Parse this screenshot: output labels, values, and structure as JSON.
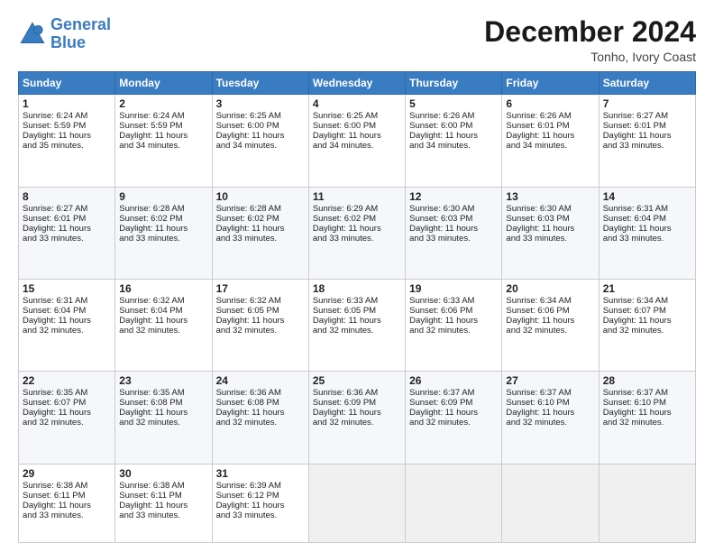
{
  "logo": {
    "line1": "General",
    "line2": "Blue"
  },
  "title": "December 2024",
  "location": "Tonho, Ivory Coast",
  "days_header": [
    "Sunday",
    "Monday",
    "Tuesday",
    "Wednesday",
    "Thursday",
    "Friday",
    "Saturday"
  ],
  "weeks": [
    [
      {
        "day": "1",
        "lines": [
          "Sunrise: 6:24 AM",
          "Sunset: 5:59 PM",
          "Daylight: 11 hours",
          "and 35 minutes."
        ]
      },
      {
        "day": "2",
        "lines": [
          "Sunrise: 6:24 AM",
          "Sunset: 5:59 PM",
          "Daylight: 11 hours",
          "and 34 minutes."
        ]
      },
      {
        "day": "3",
        "lines": [
          "Sunrise: 6:25 AM",
          "Sunset: 6:00 PM",
          "Daylight: 11 hours",
          "and 34 minutes."
        ]
      },
      {
        "day": "4",
        "lines": [
          "Sunrise: 6:25 AM",
          "Sunset: 6:00 PM",
          "Daylight: 11 hours",
          "and 34 minutes."
        ]
      },
      {
        "day": "5",
        "lines": [
          "Sunrise: 6:26 AM",
          "Sunset: 6:00 PM",
          "Daylight: 11 hours",
          "and 34 minutes."
        ]
      },
      {
        "day": "6",
        "lines": [
          "Sunrise: 6:26 AM",
          "Sunset: 6:01 PM",
          "Daylight: 11 hours",
          "and 34 minutes."
        ]
      },
      {
        "day": "7",
        "lines": [
          "Sunrise: 6:27 AM",
          "Sunset: 6:01 PM",
          "Daylight: 11 hours",
          "and 33 minutes."
        ]
      }
    ],
    [
      {
        "day": "8",
        "lines": [
          "Sunrise: 6:27 AM",
          "Sunset: 6:01 PM",
          "Daylight: 11 hours",
          "and 33 minutes."
        ]
      },
      {
        "day": "9",
        "lines": [
          "Sunrise: 6:28 AM",
          "Sunset: 6:02 PM",
          "Daylight: 11 hours",
          "and 33 minutes."
        ]
      },
      {
        "day": "10",
        "lines": [
          "Sunrise: 6:28 AM",
          "Sunset: 6:02 PM",
          "Daylight: 11 hours",
          "and 33 minutes."
        ]
      },
      {
        "day": "11",
        "lines": [
          "Sunrise: 6:29 AM",
          "Sunset: 6:02 PM",
          "Daylight: 11 hours",
          "and 33 minutes."
        ]
      },
      {
        "day": "12",
        "lines": [
          "Sunrise: 6:30 AM",
          "Sunset: 6:03 PM",
          "Daylight: 11 hours",
          "and 33 minutes."
        ]
      },
      {
        "day": "13",
        "lines": [
          "Sunrise: 6:30 AM",
          "Sunset: 6:03 PM",
          "Daylight: 11 hours",
          "and 33 minutes."
        ]
      },
      {
        "day": "14",
        "lines": [
          "Sunrise: 6:31 AM",
          "Sunset: 6:04 PM",
          "Daylight: 11 hours",
          "and 33 minutes."
        ]
      }
    ],
    [
      {
        "day": "15",
        "lines": [
          "Sunrise: 6:31 AM",
          "Sunset: 6:04 PM",
          "Daylight: 11 hours",
          "and 32 minutes."
        ]
      },
      {
        "day": "16",
        "lines": [
          "Sunrise: 6:32 AM",
          "Sunset: 6:04 PM",
          "Daylight: 11 hours",
          "and 32 minutes."
        ]
      },
      {
        "day": "17",
        "lines": [
          "Sunrise: 6:32 AM",
          "Sunset: 6:05 PM",
          "Daylight: 11 hours",
          "and 32 minutes."
        ]
      },
      {
        "day": "18",
        "lines": [
          "Sunrise: 6:33 AM",
          "Sunset: 6:05 PM",
          "Daylight: 11 hours",
          "and 32 minutes."
        ]
      },
      {
        "day": "19",
        "lines": [
          "Sunrise: 6:33 AM",
          "Sunset: 6:06 PM",
          "Daylight: 11 hours",
          "and 32 minutes."
        ]
      },
      {
        "day": "20",
        "lines": [
          "Sunrise: 6:34 AM",
          "Sunset: 6:06 PM",
          "Daylight: 11 hours",
          "and 32 minutes."
        ]
      },
      {
        "day": "21",
        "lines": [
          "Sunrise: 6:34 AM",
          "Sunset: 6:07 PM",
          "Daylight: 11 hours",
          "and 32 minutes."
        ]
      }
    ],
    [
      {
        "day": "22",
        "lines": [
          "Sunrise: 6:35 AM",
          "Sunset: 6:07 PM",
          "Daylight: 11 hours",
          "and 32 minutes."
        ]
      },
      {
        "day": "23",
        "lines": [
          "Sunrise: 6:35 AM",
          "Sunset: 6:08 PM",
          "Daylight: 11 hours",
          "and 32 minutes."
        ]
      },
      {
        "day": "24",
        "lines": [
          "Sunrise: 6:36 AM",
          "Sunset: 6:08 PM",
          "Daylight: 11 hours",
          "and 32 minutes."
        ]
      },
      {
        "day": "25",
        "lines": [
          "Sunrise: 6:36 AM",
          "Sunset: 6:09 PM",
          "Daylight: 11 hours",
          "and 32 minutes."
        ]
      },
      {
        "day": "26",
        "lines": [
          "Sunrise: 6:37 AM",
          "Sunset: 6:09 PM",
          "Daylight: 11 hours",
          "and 32 minutes."
        ]
      },
      {
        "day": "27",
        "lines": [
          "Sunrise: 6:37 AM",
          "Sunset: 6:10 PM",
          "Daylight: 11 hours",
          "and 32 minutes."
        ]
      },
      {
        "day": "28",
        "lines": [
          "Sunrise: 6:37 AM",
          "Sunset: 6:10 PM",
          "Daylight: 11 hours",
          "and 32 minutes."
        ]
      }
    ],
    [
      {
        "day": "29",
        "lines": [
          "Sunrise: 6:38 AM",
          "Sunset: 6:11 PM",
          "Daylight: 11 hours",
          "and 33 minutes."
        ]
      },
      {
        "day": "30",
        "lines": [
          "Sunrise: 6:38 AM",
          "Sunset: 6:11 PM",
          "Daylight: 11 hours",
          "and 33 minutes."
        ]
      },
      {
        "day": "31",
        "lines": [
          "Sunrise: 6:39 AM",
          "Sunset: 6:12 PM",
          "Daylight: 11 hours",
          "and 33 minutes."
        ]
      },
      null,
      null,
      null,
      null
    ]
  ]
}
